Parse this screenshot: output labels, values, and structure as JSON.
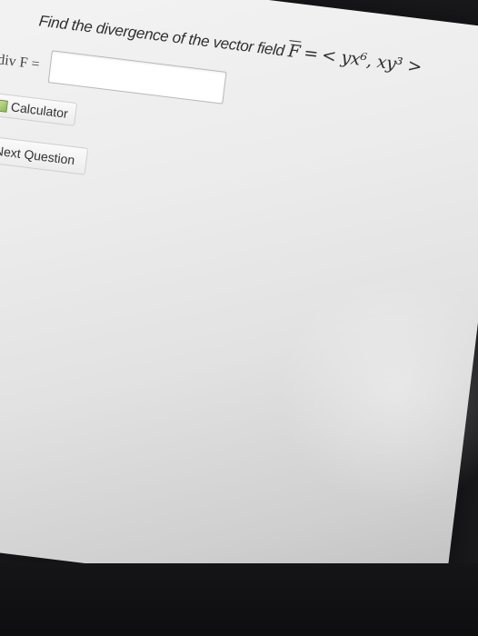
{
  "question": {
    "prefix": "Find the divergence of the vector field",
    "field_symbol": "F",
    "equals": "=",
    "expression": "< yx⁶, xy³ >"
  },
  "answer": {
    "label": "div F =",
    "value": "",
    "placeholder": ""
  },
  "calculator_button": {
    "label": "Calculator",
    "icon": "calculator-icon"
  },
  "next_button": {
    "label": "Next Question",
    "icon": "chevron-right-icon"
  }
}
